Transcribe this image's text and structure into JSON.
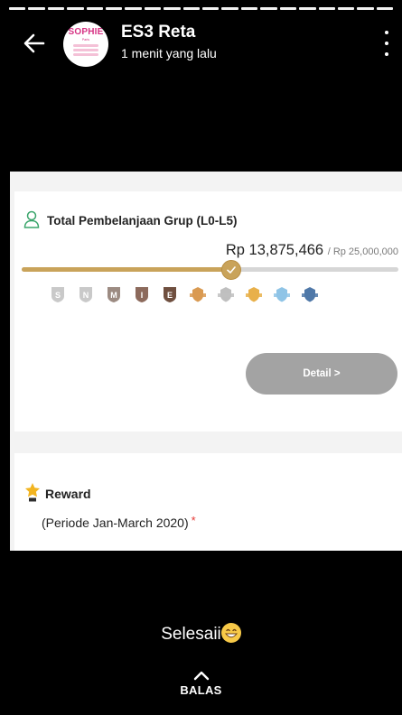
{
  "story": {
    "segments": 20,
    "user_name": "ES3 Reta",
    "time_ago": "1 menit yang lalu",
    "avatar_brand": "SOPHIE",
    "avatar_tagline": "Paris"
  },
  "screenshot": {
    "group_purchase": {
      "title": "Total Pembelanjaan Grup (L0-L5)",
      "current_amount": "Rp 13,875,466",
      "target_amount": "/ Rp 25,000,000",
      "progress_fraction": 0.555,
      "badges": [
        {
          "letter": "S",
          "color": "#c9c9c9"
        },
        {
          "letter": "N",
          "color": "#c9c9c9"
        },
        {
          "letter": "M",
          "color": "#9c8b82"
        },
        {
          "letter": "I",
          "color": "#8c6a5c"
        },
        {
          "letter": "E",
          "color": "#6f4f3f"
        },
        {
          "letter": "",
          "color": "#d99a52"
        },
        {
          "letter": "",
          "color": "#bfbfbf"
        },
        {
          "letter": "",
          "color": "#e8b04a"
        },
        {
          "letter": "",
          "color": "#8fc4e6"
        },
        {
          "letter": "",
          "color": "#4f78a8"
        }
      ],
      "detail_button": "Detail  >"
    },
    "reward": {
      "title": "Reward",
      "period": "(Periode Jan-March 2020)",
      "asterisk": "*"
    }
  },
  "caption": "Selesaii",
  "reply_label": "BALAS",
  "colors": {
    "accent_gold": "#c9a35a",
    "button_gray": "#a3a3a3",
    "user_icon_green": "#3aa56b"
  }
}
